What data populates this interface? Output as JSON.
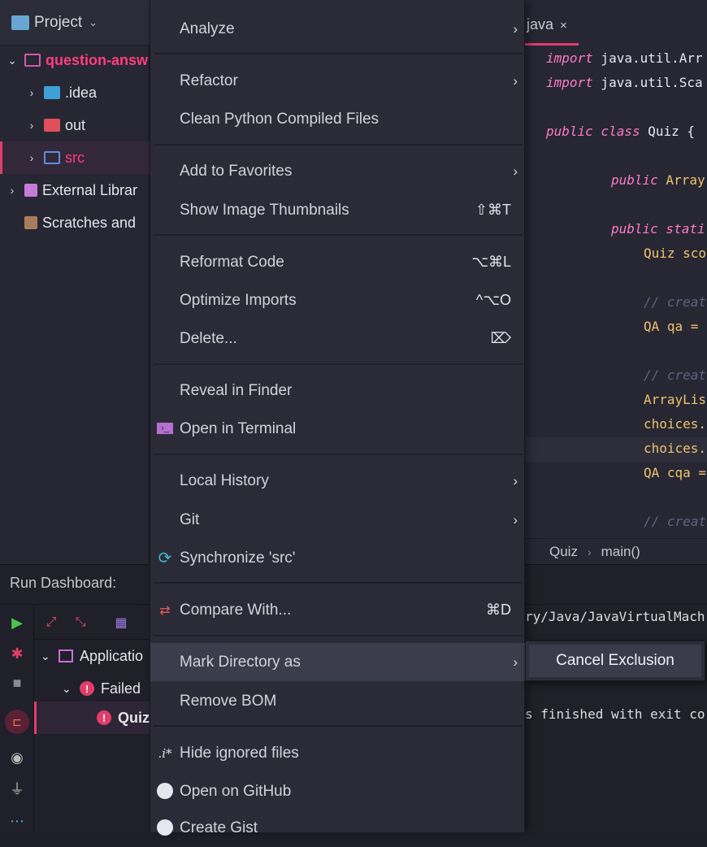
{
  "project": {
    "header": "Project",
    "tree": [
      {
        "label": "question-answ",
        "color": "#ff3d7f",
        "depth": 0,
        "expanded": true,
        "icon": "folder-icon"
      },
      {
        "label": ".idea",
        "color": "#e6e6ee",
        "depth": 1,
        "expanded": false,
        "icon": "idea-folder-icon"
      },
      {
        "label": "out",
        "color": "#e6e6ee",
        "depth": 1,
        "expanded": false,
        "icon": "excluded-folder-icon"
      },
      {
        "label": "src",
        "color": "#ff3d7f",
        "depth": 1,
        "expanded": false,
        "icon": "source-folder-icon"
      },
      {
        "label": "External Librar",
        "color": "#e6e6ee",
        "depth": 0,
        "expanded": false,
        "icon": "library-icon"
      },
      {
        "label": "Scratches and",
        "color": "#e6e6ee",
        "depth": 0,
        "expanded": null,
        "icon": "scratches-icon"
      }
    ]
  },
  "editor": {
    "tab_label": "java",
    "tab_close": "×",
    "lines": [
      {
        "kw": "import",
        "rest": " java.util.Arr"
      },
      {
        "kw": "import",
        "rest": " java.util.Sca"
      },
      {
        "kw": "public class",
        "rest": " Quiz {"
      },
      {
        "kw": "public",
        "rest": " Array"
      },
      {
        "kw": "public stati",
        "rest": ""
      },
      {
        "kw": "",
        "rest": "Quiz sco"
      },
      {
        "cm": "// creat"
      },
      {
        "kw": "",
        "rest": "QA qa ="
      },
      {
        "cm": "// creat"
      },
      {
        "kw": "",
        "rest": "ArrayLis"
      },
      {
        "kw": "",
        "rest": "choices."
      },
      {
        "kw": "",
        "rest": "choices."
      },
      {
        "kw": "",
        "rest": "QA cqa ="
      },
      {
        "cm": "// creat"
      }
    ],
    "breadcrumb": [
      "Quiz",
      "main()"
    ]
  },
  "run": {
    "title": "Run Dashboard:",
    "tree": [
      {
        "label": "Applicatio"
      },
      {
        "label": "Failed"
      },
      {
        "label": "Quiz"
      }
    ],
    "console": [
      "ry/Java/JavaVirtualMach",
      "s finished with exit co"
    ]
  },
  "context_menu": {
    "items": [
      {
        "label": "Analyze",
        "submenu": true
      },
      {
        "sep": true
      },
      {
        "label": "Refactor",
        "submenu": true
      },
      {
        "label": "Clean Python Compiled Files"
      },
      {
        "sep": true
      },
      {
        "label": "Add to Favorites",
        "submenu": true
      },
      {
        "label": "Show Image Thumbnails",
        "shortcut": "⇧⌘T"
      },
      {
        "sep": true
      },
      {
        "label": "Reformat Code",
        "shortcut": "⌥⌘L"
      },
      {
        "label": "Optimize Imports",
        "shortcut": "^⌥O"
      },
      {
        "label": "Delete...",
        "shortcut": "⌦"
      },
      {
        "sep": true
      },
      {
        "label": "Reveal in Finder"
      },
      {
        "label": "Open in Terminal",
        "icon": "terminal-icon"
      },
      {
        "sep": true
      },
      {
        "label": "Local History",
        "submenu": true
      },
      {
        "label": "Git",
        "submenu": true
      },
      {
        "label": "Synchronize 'src'",
        "icon": "sync-icon"
      },
      {
        "sep": true
      },
      {
        "label": "Compare With...",
        "shortcut": "⌘D",
        "icon": "compare-icon"
      },
      {
        "sep": true
      },
      {
        "label": "Mark Directory as",
        "submenu": true,
        "active": true
      },
      {
        "label": "Remove BOM"
      },
      {
        "sep": true
      },
      {
        "label": "Hide ignored files",
        "icon": "ignored-files-icon"
      },
      {
        "label": "Open on GitHub",
        "icon": "github-icon"
      },
      {
        "label": "Create Gist",
        "icon": "github-icon"
      }
    ]
  },
  "submenu": {
    "item": "Cancel Exclusion"
  },
  "colors": {
    "accent": "#e23d6a",
    "menu_bg": "#2a2b36",
    "editor_bg": "#262733"
  }
}
